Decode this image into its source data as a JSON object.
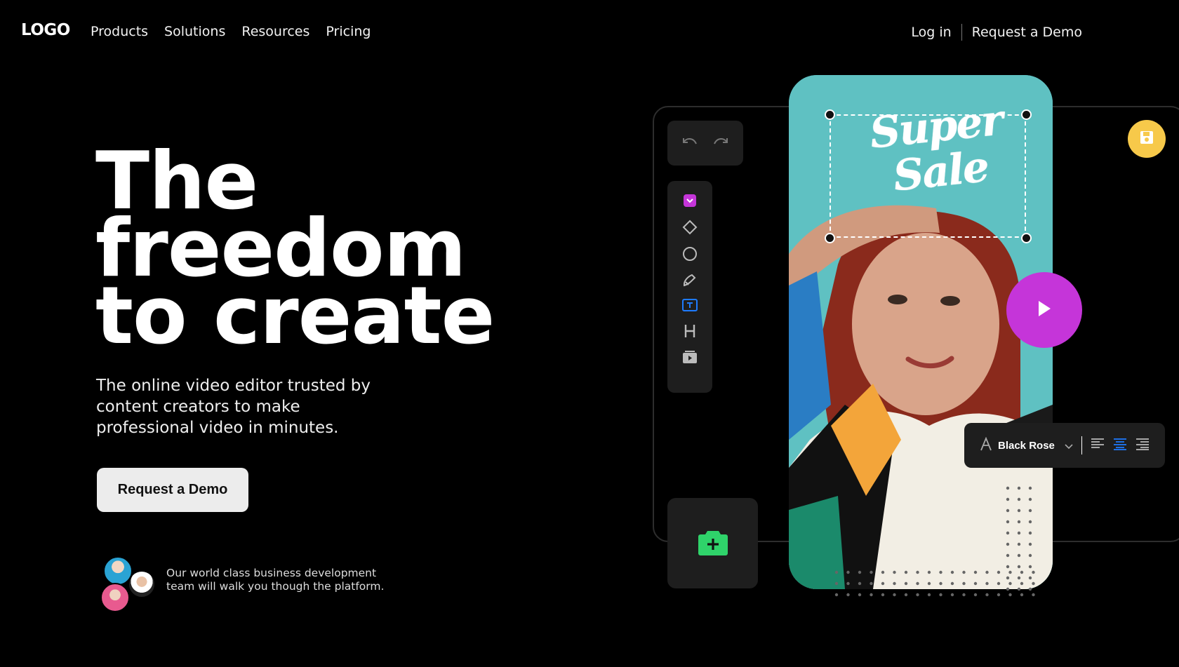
{
  "nav": {
    "logo": "LOGO",
    "links": [
      "Products",
      "Solutions",
      "Resources",
      "Pricing"
    ],
    "login": "Log in",
    "demo": "Request a Demo"
  },
  "hero": {
    "title_lines": [
      "The",
      "freedom",
      "to create"
    ],
    "subtitle": "The online video editor trusted by content creators to make professional video in minutes.",
    "cta": "Request a Demo",
    "blurb": "Our world class business development team will walk you though the platform."
  },
  "editor": {
    "overlay_text_line1": "Super",
    "overlay_text_line2": "Sale",
    "font_name": "Black Rose",
    "colors": {
      "phone_bg": "#5fc1c2",
      "play": "#c535d9",
      "save": "#f7c94a",
      "add": "#2fd36a",
      "active_tool": "#1e7bff",
      "selected_tool": "#c535d9"
    },
    "tools": [
      "undo-icon",
      "redo-icon",
      "select-icon",
      "diamond-icon",
      "circle-icon",
      "pen-icon",
      "text-icon",
      "heading-icon",
      "media-icon",
      "add-media-icon",
      "play-icon",
      "save-icon",
      "align-left-icon",
      "align-center-icon",
      "align-right-icon"
    ]
  }
}
